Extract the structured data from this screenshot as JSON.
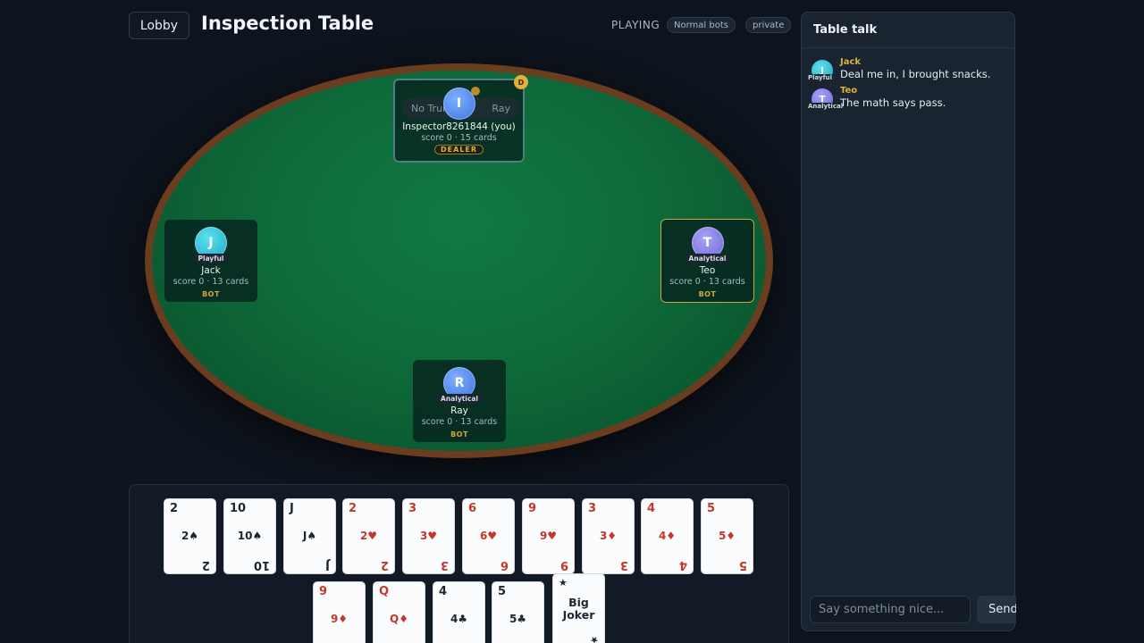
{
  "header": {
    "lobby_label": "Lobby",
    "title": "Inspection Table",
    "status": "PLAYING",
    "badge_bots": "Normal bots",
    "badge_private": "private"
  },
  "table": {
    "dealer_chip": "D",
    "seats": {
      "top": {
        "initial": "I",
        "name": "Inspector8261844 (you)",
        "score": "score 0 · 15 cards",
        "tag": "DEALER",
        "bid_left": "No Trump",
        "bid_right": "Ray"
      },
      "left": {
        "initial": "J",
        "persona": "Playful",
        "name": "Jack",
        "score": "score 0 · 13 cards",
        "tag": "BOT"
      },
      "right": {
        "initial": "T",
        "persona": "Analytical",
        "name": "Teo",
        "score": "score 0 · 13 cards",
        "tag": "BOT"
      },
      "bottom": {
        "initial": "R",
        "persona": "Analytical",
        "name": "Ray",
        "score": "score 0 · 13 cards",
        "tag": "BOT"
      }
    }
  },
  "hand": {
    "cards": [
      {
        "rank": "2",
        "suit": "♠",
        "color": "black"
      },
      {
        "rank": "10",
        "suit": "♠",
        "color": "black"
      },
      {
        "rank": "J",
        "suit": "♠",
        "color": "black"
      },
      {
        "rank": "2",
        "suit": "♥",
        "color": "red"
      },
      {
        "rank": "3",
        "suit": "♥",
        "color": "red"
      },
      {
        "rank": "6",
        "suit": "♥",
        "color": "red"
      },
      {
        "rank": "9",
        "suit": "♥",
        "color": "red"
      },
      {
        "rank": "3",
        "suit": "♦",
        "color": "red"
      },
      {
        "rank": "4",
        "suit": "♦",
        "color": "red"
      },
      {
        "rank": "5",
        "suit": "♦",
        "color": "red"
      },
      {
        "rank": "9",
        "suit": "♦",
        "color": "red"
      },
      {
        "rank": "Q",
        "suit": "♦",
        "color": "red"
      },
      {
        "rank": "4",
        "suit": "♣",
        "color": "black"
      },
      {
        "rank": "5",
        "suit": "♣",
        "color": "black"
      }
    ],
    "joker": {
      "star": "★",
      "line1": "Big",
      "line2": "Joker"
    }
  },
  "chat": {
    "title": "Table talk",
    "messages": [
      {
        "initial": "J",
        "persona": "Playful",
        "name": "Jack",
        "text": "Deal me in, I brought snacks."
      },
      {
        "initial": "T",
        "persona": "Analytical",
        "name": "Teo",
        "text": "The math says pass."
      }
    ],
    "input_placeholder": "Say something nice...",
    "send_label": "Send"
  },
  "colors": {
    "accent_gold": "#e0b13a",
    "felt": "#0e6a3a",
    "rail": "#6a3d1f",
    "red_suit": "#c0392b"
  }
}
